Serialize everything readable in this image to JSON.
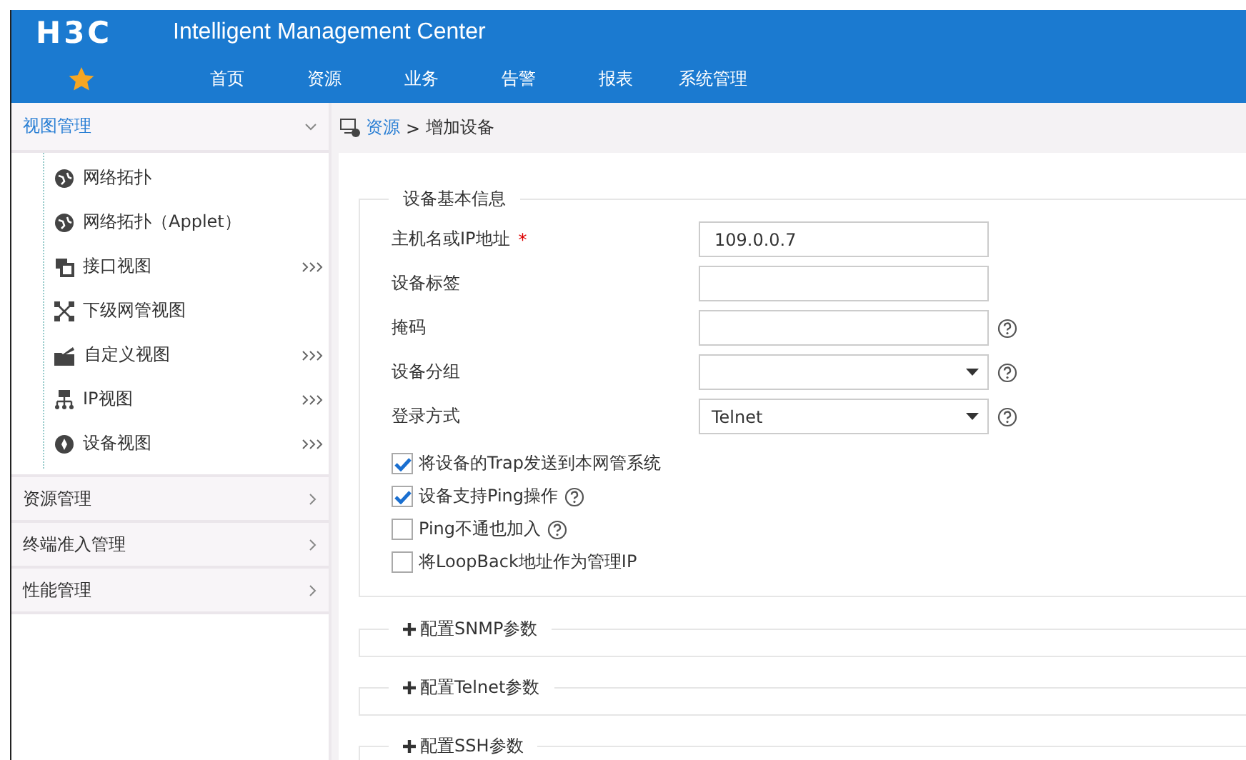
{
  "header": {
    "logo": "H3C",
    "title": "Intelligent Management Center",
    "nav": [
      "首页",
      "资源",
      "业务",
      "告警",
      "报表",
      "系统管理"
    ]
  },
  "sidebar": {
    "groups": [
      {
        "label": "视图管理",
        "expanded": true,
        "items": [
          {
            "label": "网络拓扑",
            "submenu": false
          },
          {
            "label": "网络拓扑（Applet）",
            "submenu": false
          },
          {
            "label": "接口视图",
            "submenu": true
          },
          {
            "label": "下级网管视图",
            "submenu": false
          },
          {
            "label": "自定义视图",
            "submenu": true
          },
          {
            "label": "IP视图",
            "submenu": true
          },
          {
            "label": "设备视图",
            "submenu": true
          }
        ]
      },
      {
        "label": "资源管理",
        "expanded": false
      },
      {
        "label": "终端准入管理",
        "expanded": false
      },
      {
        "label": "性能管理",
        "expanded": false
      }
    ]
  },
  "breadcrumb": {
    "link": "资源",
    "separator": ">",
    "current": "增加设备"
  },
  "form": {
    "legend": "设备基本信息",
    "fields": [
      {
        "kind": "text",
        "label": "主机名或IP地址",
        "required_mark": "*",
        "value": "109.0.0.7",
        "help": false
      },
      {
        "kind": "text",
        "label": "设备标签",
        "help": false
      },
      {
        "kind": "text",
        "label": "掩码",
        "help": true
      },
      {
        "kind": "select",
        "label": "设备分组",
        "help": true
      },
      {
        "kind": "select",
        "label": "登录方式",
        "value": "Telnet",
        "help": true
      }
    ],
    "checks": [
      {
        "label": "将设备的Trap发送到本网管系统",
        "checked": true,
        "help": false
      },
      {
        "label": "设备支持Ping操作",
        "checked": true,
        "help": true
      },
      {
        "label": "Ping不通也加入",
        "checked": false,
        "help": true
      },
      {
        "label": "将LoopBack地址作为管理IP",
        "checked": false,
        "help": false
      }
    ]
  },
  "sections": [
    {
      "label": "配置SNMP参数",
      "expanded": false
    },
    {
      "label": "配置Telnet参数",
      "expanded": false
    },
    {
      "label": "配置SSH参数",
      "expanded": false
    }
  ]
}
